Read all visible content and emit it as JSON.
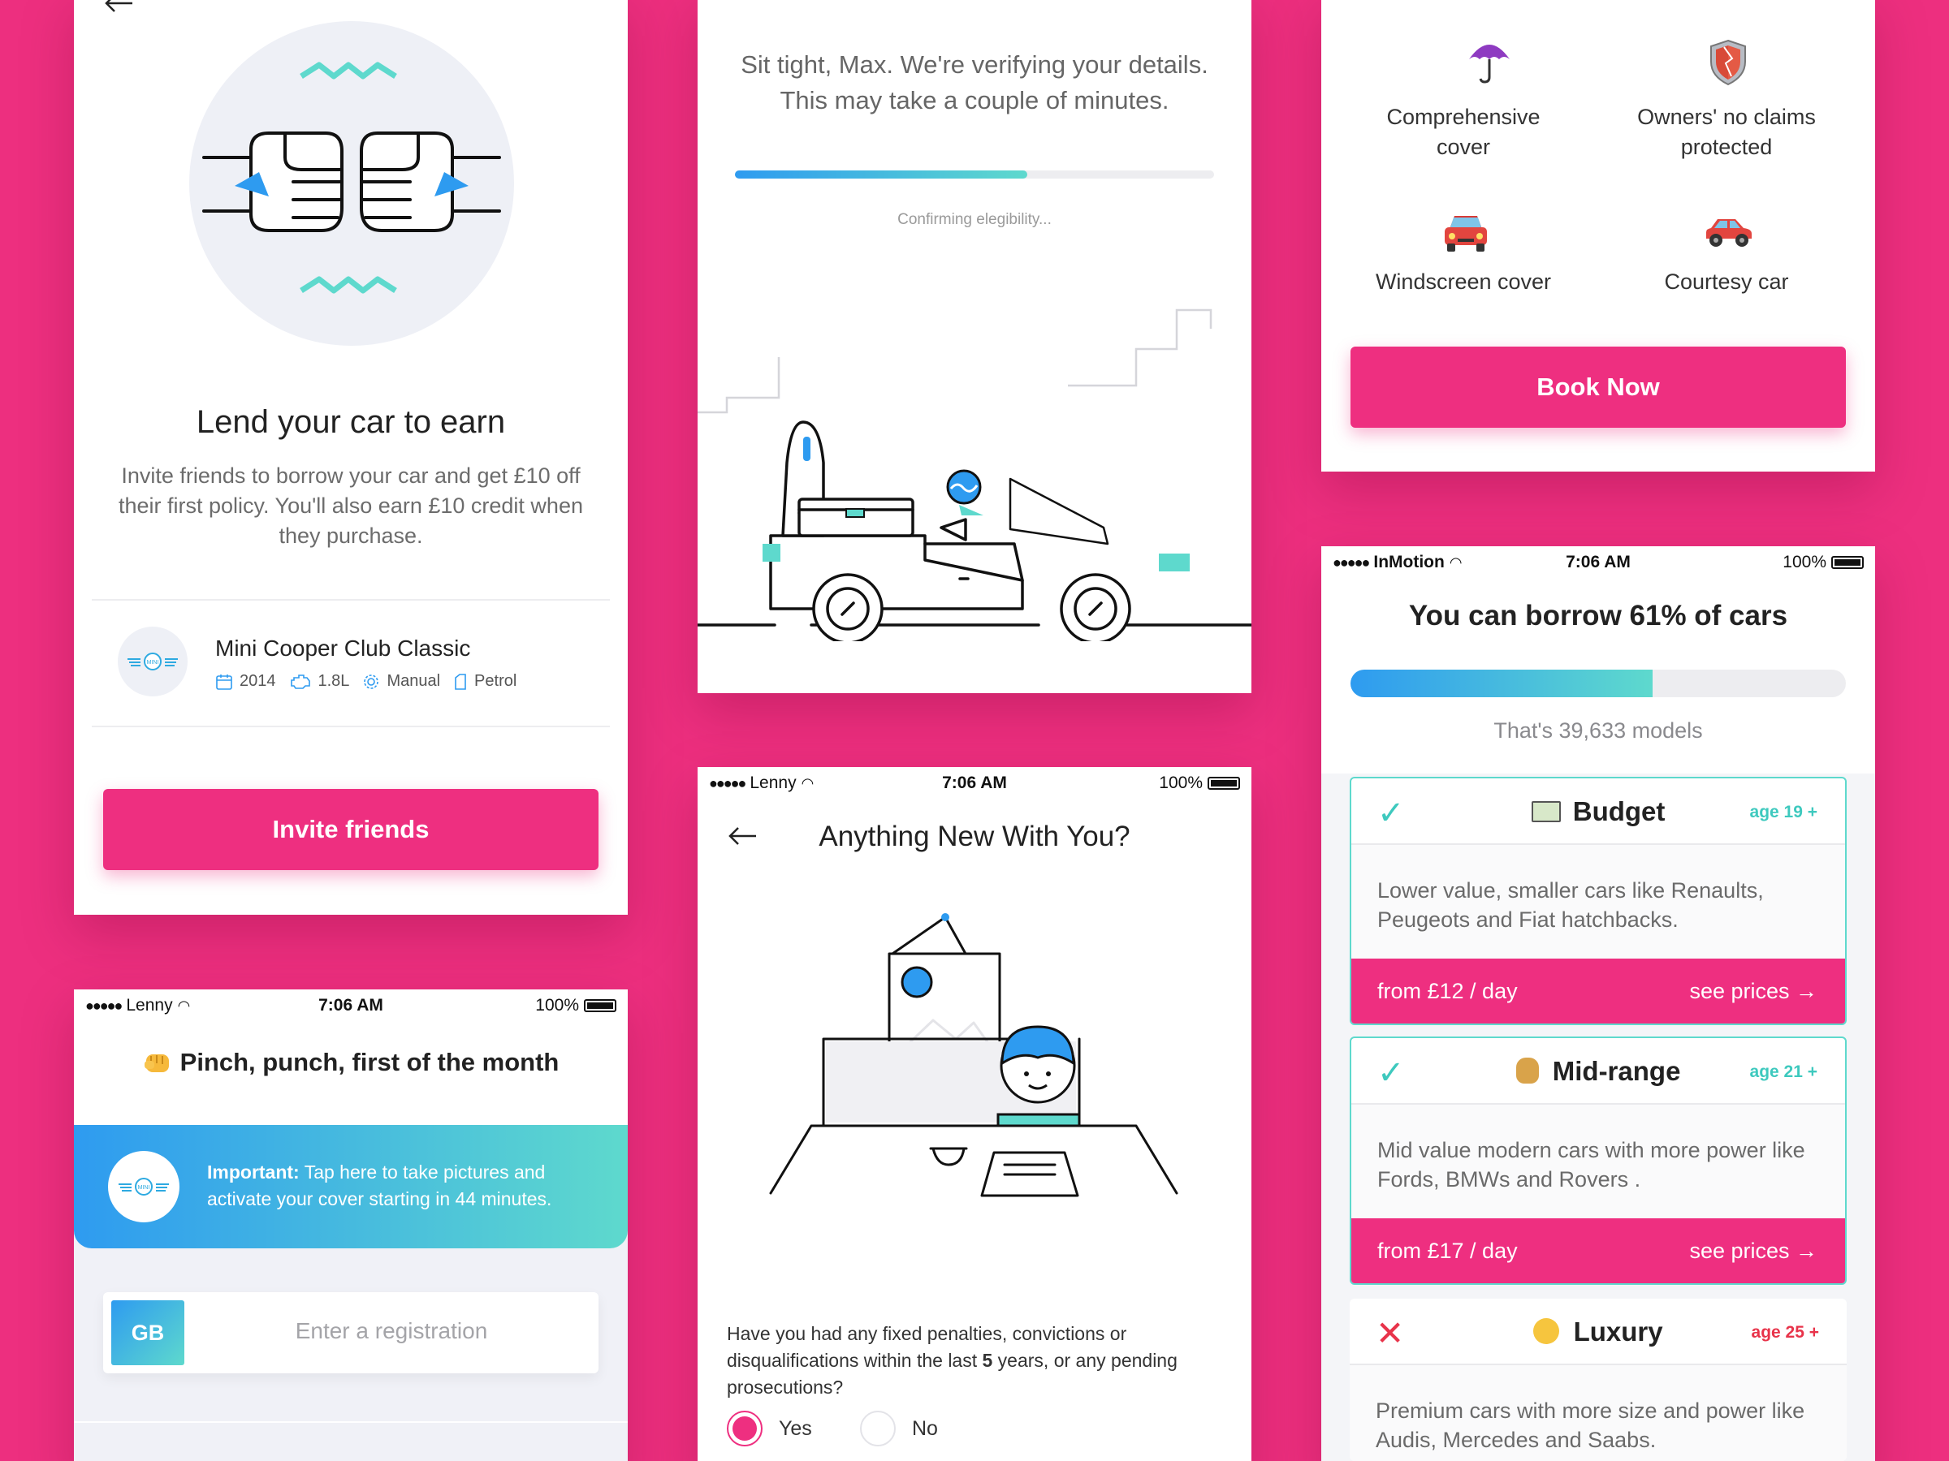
{
  "colors": {
    "background": "#ED2F7F",
    "accent_pink": "#EE2F80",
    "teal": "#5ED9CD",
    "blue": "#2E9BF0"
  },
  "lend": {
    "title": "Lend your car to earn",
    "desc_lines": [
      "Invite friends to borrow your car and get £10 off",
      "their first policy. You'll also earn £10 credit when",
      "they purchase."
    ],
    "car_name": "Mini Cooper Club Classic",
    "specs": [
      {
        "icon": "calendar-icon",
        "text": "2014"
      },
      {
        "icon": "engine-icon",
        "text": "1.8L"
      },
      {
        "icon": "gear-icon",
        "text": "Manual"
      },
      {
        "icon": "fuel-icon",
        "text": "Petrol"
      }
    ],
    "logo_text": "MINI",
    "button": "Invite friends"
  },
  "verify": {
    "lines": [
      "Sit tight, Max. We're verifying your details.",
      "This may take a couple of minutes."
    ],
    "progress": 0.61,
    "status": "Confirming elegibility..."
  },
  "cover": {
    "features": [
      {
        "icon": "umbrella-icon",
        "lines": [
          "Comprehensive",
          "cover"
        ]
      },
      {
        "icon": "shield-icon",
        "lines": [
          "Owners' no claims",
          "protected"
        ]
      },
      {
        "icon": "car-front-icon",
        "lines": [
          "Windscreen cover"
        ]
      },
      {
        "icon": "car-side-icon",
        "lines": [
          "Courtesy car"
        ]
      }
    ],
    "button": "Book Now"
  },
  "pinch": {
    "status": {
      "carrier": "Lenny",
      "time": "7:06 AM",
      "battery": "100%"
    },
    "title": "Pinch, punch, first of the month",
    "banner_bold": "Important:",
    "banner_text_1": "Tap here to take pictures and",
    "banner_text_2": "activate your cover starting in 44 minutes.",
    "logo_text": "MINI",
    "country": "GB",
    "reg_placeholder": "Enter a registration"
  },
  "anything": {
    "status": {
      "carrier": "Lenny",
      "time": "7:06 AM",
      "battery": "100%"
    },
    "title": "Anything New With You?",
    "q1": "Have you had any fixed penalties, convictions or",
    "q2a": "disqualifications within the last ",
    "q2b": "5",
    "q2c": " years, or any pending",
    "q3": "prosecutions?",
    "yes": "Yes",
    "no": "No",
    "selected": "Yes"
  },
  "borrow": {
    "status": {
      "carrier": "InMotion",
      "time": "7:06 AM",
      "battery": "100%"
    },
    "title": "You can borrow 61% of cars",
    "progress": 0.61,
    "subtitle": "That's 39,633 models",
    "tiers": [
      {
        "icon": "money-icon",
        "name": "Budget",
        "age": "age 19 +",
        "age_color": "#3EC9BE",
        "lines": [
          "Lower value, smaller cars like Renaults,",
          "Peugeots and Fiat hatchbacks."
        ],
        "price": "from £12 / day",
        "link": "see prices →",
        "selected": true
      },
      {
        "icon": "money-bag-icon",
        "name": "Mid-range",
        "age": "age 21 +",
        "age_color": "#3EC9BE",
        "lines": [
          "Mid value modern cars with more power like",
          "Fords, BMWs and Rovers ."
        ],
        "price": "from £17 / day",
        "link": "see prices →",
        "selected": true
      },
      {
        "icon": "money-face-icon",
        "name": "Luxury",
        "age": "age 25 +",
        "age_color": "#E8334A",
        "lines": [
          "Premium cars with more size and power like",
          "Audis, Mercedes and Saabs."
        ],
        "selected": false
      }
    ]
  }
}
